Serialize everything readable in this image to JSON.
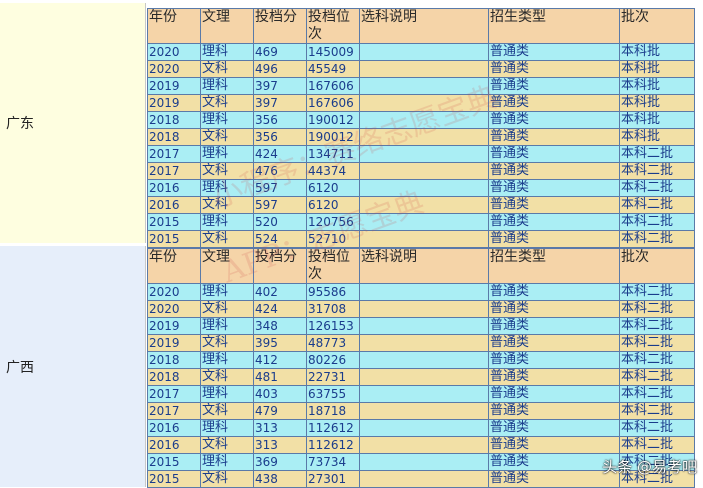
{
  "header": {
    "year": "年份",
    "subject": "文理",
    "score": "投档分",
    "rank": "投档位次",
    "subject_note": "选科说明",
    "type": "招生类型",
    "batch": "批次"
  },
  "provinces": [
    {
      "name": "广东",
      "rows": [
        {
          "year": "2020",
          "subject": "理科",
          "score": "469",
          "rank": "145009",
          "note": "",
          "type": "普通类",
          "batch": "本科批"
        },
        {
          "year": "2020",
          "subject": "文科",
          "score": "496",
          "rank": "45549",
          "note": "",
          "type": "普通类",
          "batch": "本科批"
        },
        {
          "year": "2019",
          "subject": "理科",
          "score": "397",
          "rank": "167606",
          "note": "",
          "type": "普通类",
          "batch": "本科批"
        },
        {
          "year": "2019",
          "subject": "文科",
          "score": "397",
          "rank": "167606",
          "note": "",
          "type": "普通类",
          "batch": "本科批"
        },
        {
          "year": "2018",
          "subject": "理科",
          "score": "356",
          "rank": "190012",
          "note": "",
          "type": "普通类",
          "batch": "本科批"
        },
        {
          "year": "2018",
          "subject": "文科",
          "score": "356",
          "rank": "190012",
          "note": "",
          "type": "普通类",
          "batch": "本科批"
        },
        {
          "year": "2017",
          "subject": "理科",
          "score": "424",
          "rank": "134711",
          "note": "",
          "type": "普通类",
          "batch": "本科二批"
        },
        {
          "year": "2017",
          "subject": "文科",
          "score": "476",
          "rank": "44374",
          "note": "",
          "type": "普通类",
          "batch": "本科二批"
        },
        {
          "year": "2016",
          "subject": "理科",
          "score": "597",
          "rank": "6120",
          "note": "",
          "type": "普通类",
          "batch": "本科二批"
        },
        {
          "year": "2016",
          "subject": "文科",
          "score": "597",
          "rank": "6120",
          "note": "",
          "type": "普通类",
          "batch": "本科二批"
        },
        {
          "year": "2015",
          "subject": "理科",
          "score": "520",
          "rank": "120756",
          "note": "",
          "type": "普通类",
          "batch": "本科二批"
        },
        {
          "year": "2015",
          "subject": "文科",
          "score": "524",
          "rank": "52710",
          "note": "",
          "type": "普通类",
          "batch": "本科二批"
        }
      ]
    },
    {
      "name": "广西",
      "rows": [
        {
          "year": "2020",
          "subject": "理科",
          "score": "402",
          "rank": "95586",
          "note": "",
          "type": "普通类",
          "batch": "本科二批"
        },
        {
          "year": "2020",
          "subject": "文科",
          "score": "424",
          "rank": "31708",
          "note": "",
          "type": "普通类",
          "batch": "本科二批"
        },
        {
          "year": "2019",
          "subject": "理科",
          "score": "348",
          "rank": "126153",
          "note": "",
          "type": "普通类",
          "batch": "本科二批"
        },
        {
          "year": "2019",
          "subject": "文科",
          "score": "395",
          "rank": "48773",
          "note": "",
          "type": "普通类",
          "batch": "本科二批"
        },
        {
          "year": "2018",
          "subject": "理科",
          "score": "412",
          "rank": "80226",
          "note": "",
          "type": "普通类",
          "batch": "本科二批"
        },
        {
          "year": "2018",
          "subject": "文科",
          "score": "481",
          "rank": "22731",
          "note": "",
          "type": "普通类",
          "batch": "本科二批"
        },
        {
          "year": "2017",
          "subject": "理科",
          "score": "403",
          "rank": "63755",
          "note": "",
          "type": "普通类",
          "batch": "本科二批"
        },
        {
          "year": "2017",
          "subject": "文科",
          "score": "479",
          "rank": "18718",
          "note": "",
          "type": "普通类",
          "batch": "本科二批"
        },
        {
          "year": "2016",
          "subject": "理科",
          "score": "313",
          "rank": "112612",
          "note": "",
          "type": "普通类",
          "batch": "本科二批"
        },
        {
          "year": "2016",
          "subject": "文科",
          "score": "313",
          "rank": "112612",
          "note": "",
          "type": "普通类",
          "batch": "本科二批"
        },
        {
          "year": "2015",
          "subject": "理科",
          "score": "369",
          "rank": "73734",
          "note": "",
          "type": "普通类",
          "batch": "本科二批"
        },
        {
          "year": "2015",
          "subject": "文科",
          "score": "438",
          "rank": "27301",
          "note": "",
          "type": "普通类",
          "batch": "本科二批"
        }
      ]
    }
  ],
  "watermark": {
    "line1": "小程序：赛络志愿宝典",
    "line2": "APP：志愿宝典"
  },
  "source_badge": "头条 @易考吧",
  "colors": {
    "header_bg": "#f5d4a8",
    "row_cyan": "#aaeef4",
    "row_tan": "#f2e0a6",
    "province_gd_bg": "#fefee0",
    "province_gx_bg": "#e6eefa",
    "text_blue": "#1a3c8c"
  }
}
